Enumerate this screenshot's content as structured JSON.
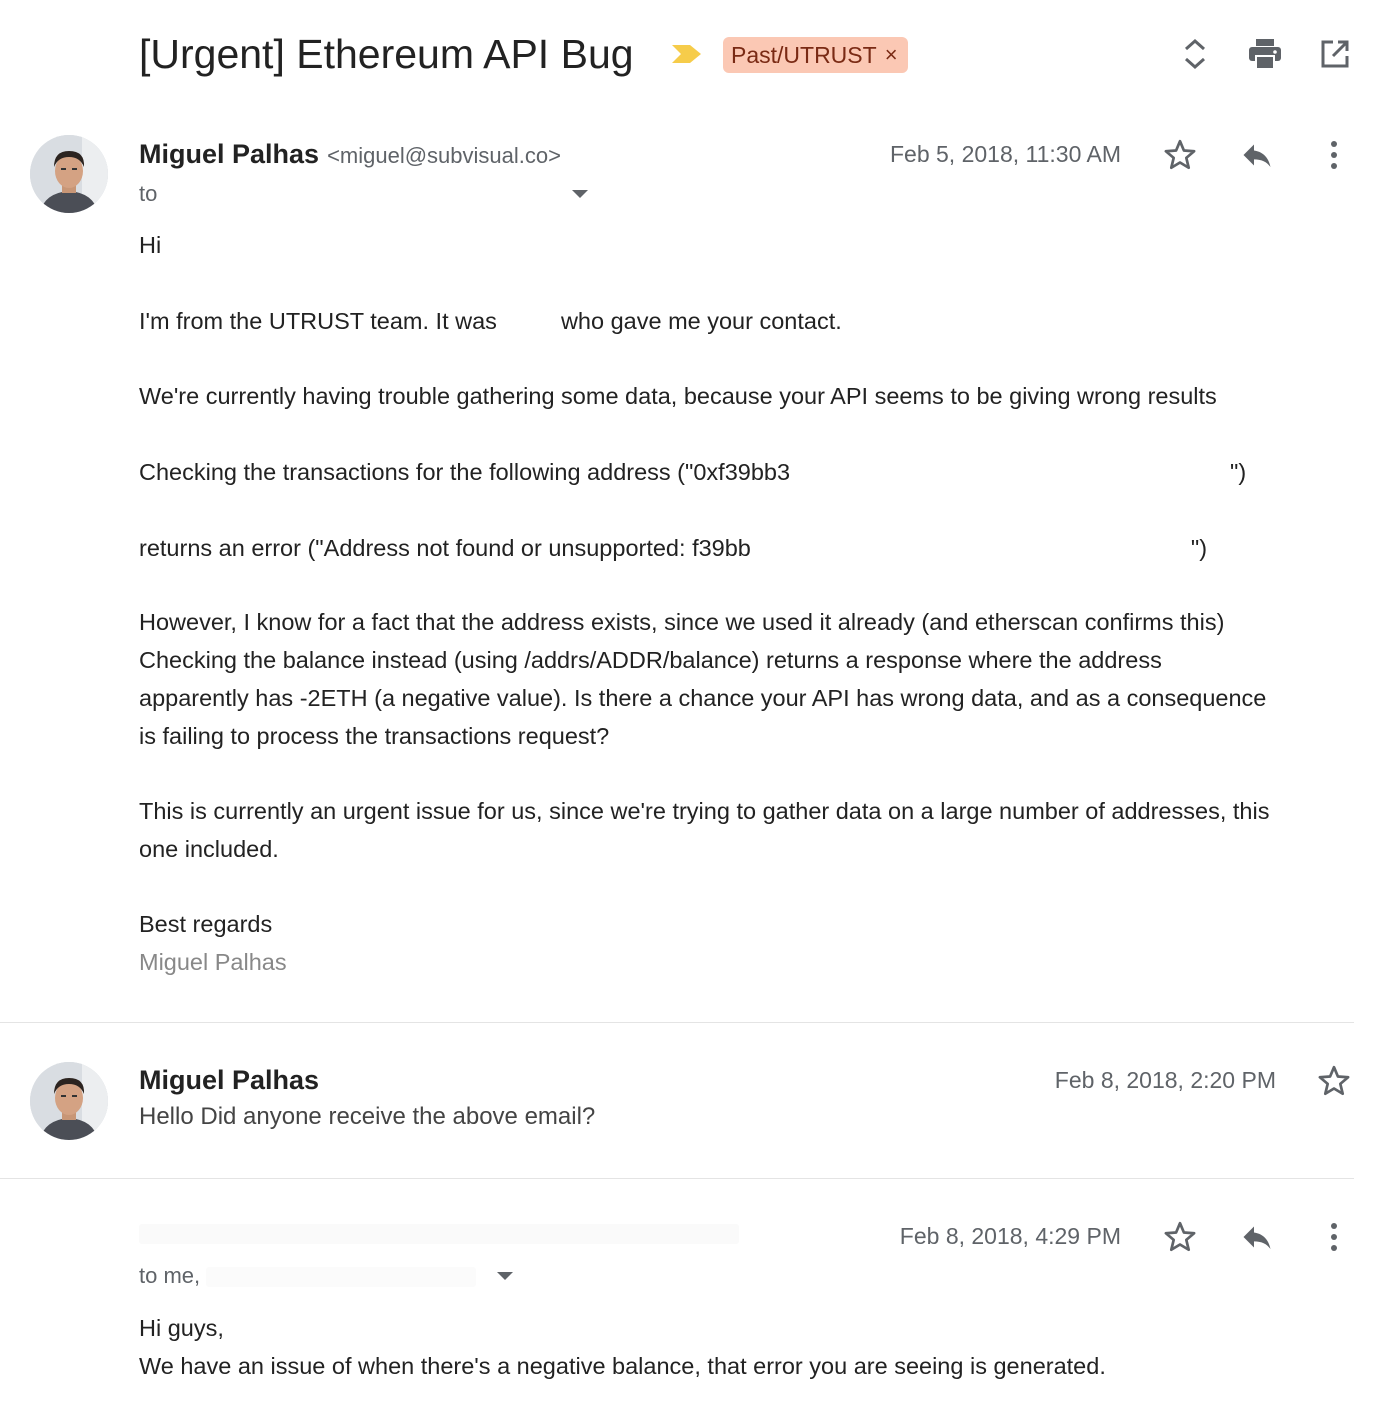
{
  "thread": {
    "subject": "[Urgent] Ethereum API Bug",
    "label": "Past/UTRUST",
    "label_remove": "×",
    "label_color": "#fbc8b4",
    "importance_color": "#f6cc4a",
    "icons": [
      "expand-collapse-icon",
      "print-icon",
      "open-in-new-window-icon"
    ]
  },
  "messages": [
    {
      "sender_name": "Miguel Palhas",
      "sender_email": "<miguel@subvisual.co>",
      "date": "Feb 5, 2018, 11:30 AM",
      "to_label": "to",
      "body": {
        "greeting": "Hi",
        "p1_part1": "I'm from the UTRUST team. It was",
        "p1_part2": "who gave me your contact.",
        "p2": "We're currently having trouble gathering some data, because your API seems to be giving wrong results",
        "p3_part1": "Checking the transactions for the following address (\"0xf39bb3",
        "p3_part2": "\")",
        "p4_part1": "returns an error (\"Address not found or unsupported: f39bb",
        "p4_part2": "\")",
        "p5": [
          "However, I know for a fact that the address exists, since we used it already (and etherscan confirms this)",
          "Checking the balance instead (using /addrs/ADDR/balance) returns a response where the address",
          "apparently has -2ETH (a negative value). Is there a chance your API has wrong data, and as a consequence",
          "is failing to process the transactions request?"
        ],
        "p6": [
          "This is currently an urgent issue for us, since we're trying to gather data on a large number of addresses, this",
          "one included."
        ],
        "closing": "Best regards",
        "signature": "Miguel Palhas"
      }
    },
    {
      "sender_name": "Miguel Palhas",
      "date": "Feb 8, 2018, 2:20 PM",
      "snippet": "Hello Did anyone receive the above email?"
    },
    {
      "date": "Feb 8, 2018, 4:29 PM",
      "to_label": "to me,",
      "body": {
        "line1": "Hi guys,",
        "line2": "We have an issue of when there's a negative balance, that error you are seeing is generated."
      }
    }
  ]
}
